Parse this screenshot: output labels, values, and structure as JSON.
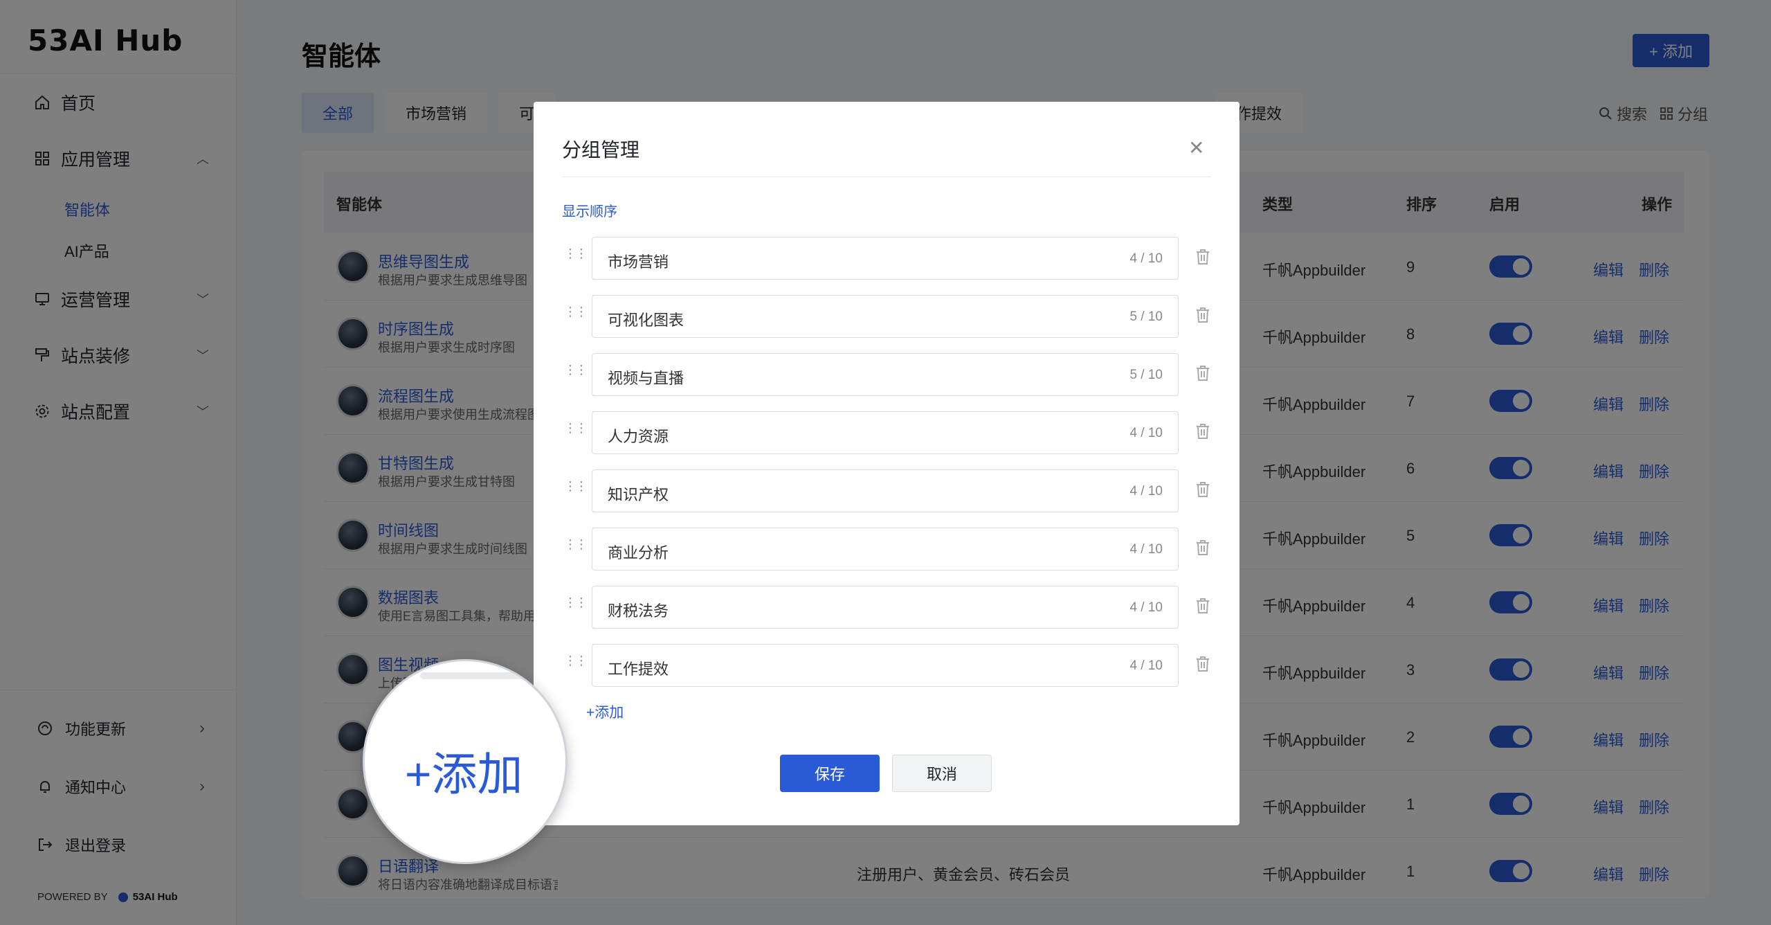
{
  "app": {
    "logo": "53AI Hub"
  },
  "sidebar": {
    "items": [
      {
        "label": "首页"
      },
      {
        "label": "应用管理"
      },
      {
        "label": "运营管理"
      },
      {
        "label": "站点装修"
      },
      {
        "label": "站点配置"
      }
    ],
    "sub_items": [
      {
        "label": "智能体"
      },
      {
        "label": "AI产品"
      }
    ],
    "footer": [
      {
        "label": "功能更新"
      },
      {
        "label": "通知中心"
      },
      {
        "label": "退出登录"
      }
    ],
    "powered_by": "POWERED BY",
    "powered_brand": "53AI Hub"
  },
  "main": {
    "title": "智能体",
    "add_label": "+ 添加",
    "tabs": [
      "全部",
      "市场营销",
      "可"
    ],
    "tab_partial_right": "作提效",
    "search_label": "搜索",
    "group_label": "分组",
    "columns": {
      "name": "智能体",
      "type": "类型",
      "sort": "排序",
      "enabled": "启用",
      "actions": "操作"
    },
    "rows": [
      {
        "name": "思维导图生成",
        "desc": "根据用户要求生成思维导图",
        "members": "",
        "type": "千帆Appbuilder",
        "sort": "9",
        "edit": "编辑",
        "del": "删除"
      },
      {
        "name": "时序图生成",
        "desc": "根据用户要求生成时序图",
        "members": "",
        "type": "千帆Appbuilder",
        "sort": "8",
        "edit": "编辑",
        "del": "删除"
      },
      {
        "name": "流程图生成",
        "desc": "根据用户要求使用生成流程图",
        "members": "",
        "type": "千帆Appbuilder",
        "sort": "7",
        "edit": "编辑",
        "del": "删除"
      },
      {
        "name": "甘特图生成",
        "desc": "根据用户要求生成甘特图",
        "members": "",
        "type": "千帆Appbuilder",
        "sort": "6",
        "edit": "编辑",
        "del": "删除"
      },
      {
        "name": "时间线图",
        "desc": "根据用户要求生成时间线图",
        "members": "",
        "type": "千帆Appbuilder",
        "sort": "5",
        "edit": "编辑",
        "del": "删除"
      },
      {
        "name": "数据图表",
        "desc": "使用E言易图工具集，帮助用",
        "members": "",
        "type": "千帆Appbuilder",
        "sort": "4",
        "edit": "编辑",
        "del": "删除"
      },
      {
        "name": "图生视频",
        "desc": "上传图",
        "members": "",
        "type": "千帆Appbuilder",
        "sort": "3",
        "edit": "编辑",
        "del": "删除"
      },
      {
        "name": "",
        "desc": "",
        "members": "",
        "type": "千帆Appbuilder",
        "sort": "2",
        "edit": "编辑",
        "del": "删除"
      },
      {
        "name": "",
        "desc": "",
        "members": "",
        "type": "千帆Appbuilder",
        "sort": "1",
        "edit": "编辑",
        "del": "删除"
      },
      {
        "name": "日语翻译",
        "desc": "将日语内容准确地翻译成目标语言",
        "members": "注册用户、黄金会员、砖石会员",
        "type": "千帆Appbuilder",
        "sort": "1",
        "edit": "编辑",
        "del": "删除"
      }
    ]
  },
  "modal": {
    "title": "分组管理",
    "close_icon": "close-icon",
    "order_label": "显示顺序",
    "groups": [
      {
        "value": "市场营销",
        "count": "4 / 10"
      },
      {
        "value": "可视化图表",
        "count": "5 / 10"
      },
      {
        "value": "视频与直播",
        "count": "5 / 10"
      },
      {
        "value": "人力资源",
        "count": "4 / 10"
      },
      {
        "value": "知识产权",
        "count": "4 / 10"
      },
      {
        "value": "商业分析",
        "count": "4 / 10"
      },
      {
        "value": "财税法务",
        "count": "4 / 10"
      },
      {
        "value": "工作提效",
        "count": "4 / 10"
      }
    ],
    "add_label": "+添加",
    "save_label": "保存",
    "cancel_label": "取消"
  },
  "magnifier": {
    "text": "+添加"
  },
  "colors": {
    "accent": "#2a5bd7",
    "overlay": "rgba(0,0,0,0.5)"
  }
}
